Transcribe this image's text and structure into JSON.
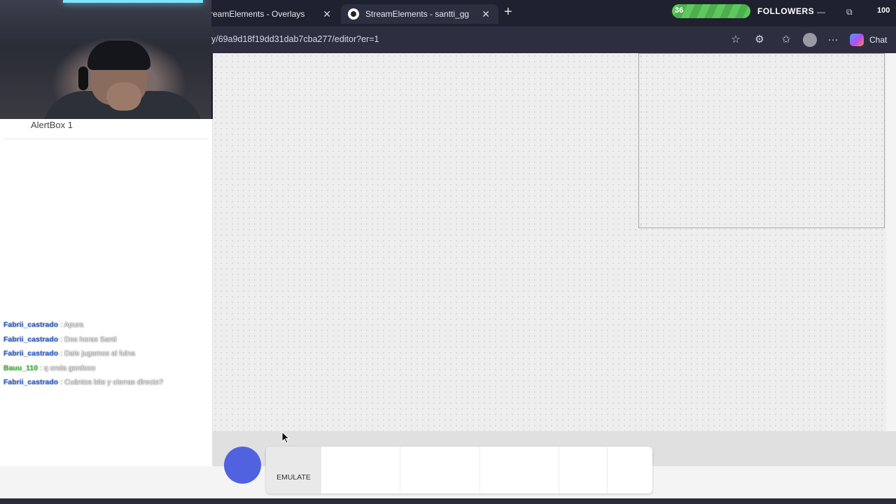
{
  "tabs": [
    {
      "label": "reamElements - Overlays",
      "close": "✕"
    },
    {
      "label": "StreamElements - santti_gg",
      "close": "✕"
    }
  ],
  "new_tab": "+",
  "address": {
    "url": "y/69a9d18f19dd31dab7cba277/editor?er=1"
  },
  "toolbar": {
    "chat_label": "Chat",
    "more": "···"
  },
  "followers": {
    "count": "36",
    "label": "FOLLOWERS",
    "goal": "100"
  },
  "window_controls": {
    "minimize": "—",
    "restore": "⧉"
  },
  "panel": {
    "title": "AlertBox 1"
  },
  "chat": [
    {
      "user": "Fabrii_castrado",
      "user_color": "#2f5fd0",
      "message": ": Apura"
    },
    {
      "user": "Fabrii_castrado",
      "user_color": "#2f5fd0",
      "message": ": Dos horas Santi"
    },
    {
      "user": "Fabrii_castrado",
      "user_color": "#2f5fd0",
      "message": ": Dale jugamos al fulna"
    },
    {
      "user": "Bauu_110",
      "user_color": "#3fbf3f",
      "message": ": q onda gordooo"
    },
    {
      "user": "Fabrii_castrado",
      "user_color": "#2f5fd0",
      "message": ": Cuántos bits y cierras directo?"
    }
  ],
  "emulate": {
    "label": "EMULATE"
  },
  "colors": {
    "accent": "#5062e0",
    "followers_green": "#5ec85e"
  }
}
